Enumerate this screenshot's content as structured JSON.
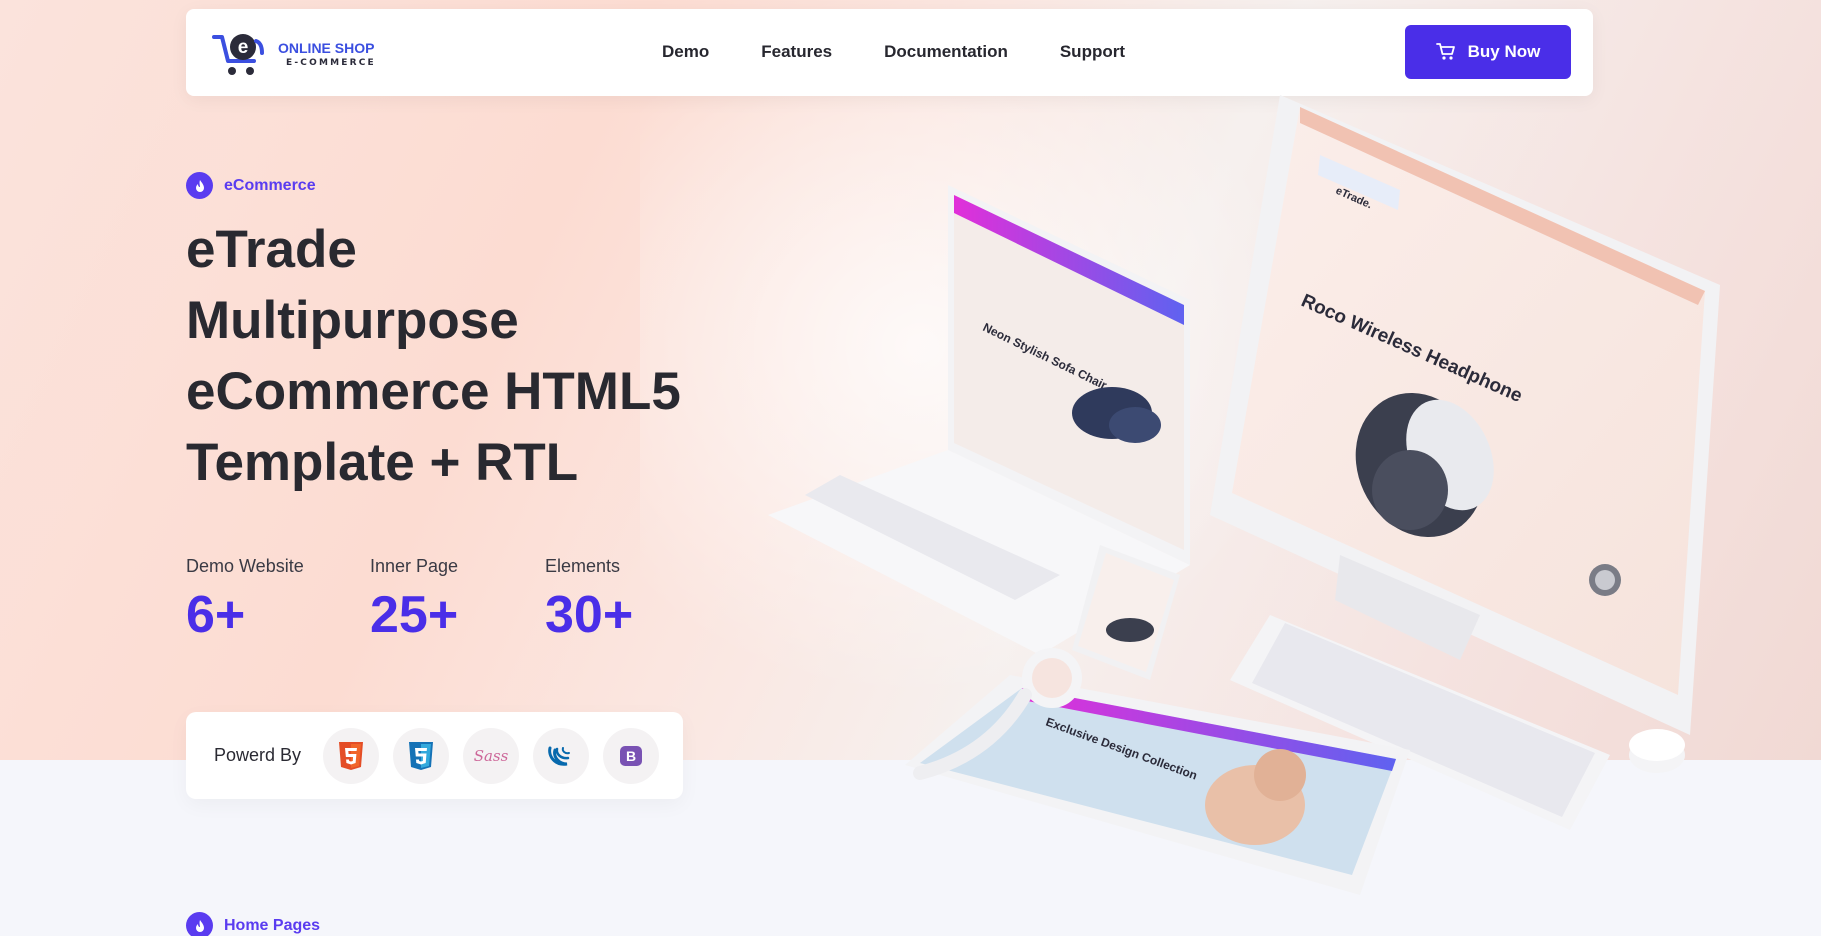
{
  "header": {
    "logo": {
      "title": "ONLINE SHOP",
      "subtitle": "E-COMMERCE"
    },
    "nav": [
      {
        "label": "Demo"
      },
      {
        "label": "Features"
      },
      {
        "label": "Documentation"
      },
      {
        "label": "Support"
      }
    ],
    "buy_button": {
      "label": "Buy Now",
      "icon": "cart-icon"
    }
  },
  "hero": {
    "badge": {
      "label": "eCommerce",
      "icon": "flame-icon"
    },
    "title_lines": [
      "eTrade",
      "Multipurpose",
      "eCommerce HTML5",
      "Template + RTL"
    ],
    "stats": [
      {
        "label": "Demo Website",
        "value": "6+"
      },
      {
        "label": "Inner Page",
        "value": "25+"
      },
      {
        "label": "Elements",
        "value": "30+"
      }
    ],
    "powered_by": {
      "label": "Powerd By",
      "technologies": [
        {
          "name": "HTML5",
          "icon": "html5-icon",
          "color": "#e44d26"
        },
        {
          "name": "CSS3",
          "icon": "css3-icon",
          "color": "#1572b6"
        },
        {
          "name": "Sass",
          "icon": "sass-icon",
          "color": "#cd6799"
        },
        {
          "name": "jQuery",
          "icon": "jquery-icon",
          "color": "#0769ad"
        },
        {
          "name": "Bootstrap",
          "icon": "bootstrap-icon",
          "color": "#7952b3"
        }
      ]
    }
  },
  "mockup": {
    "laptop_text": "Neon Stylish Sofa Chair",
    "monitor_logo": "eTrade.",
    "monitor_text": "Roco Wireless Headphone",
    "tablet_text": "Exclusive Design Collection"
  },
  "next_section": {
    "badge_label": "Home Pages"
  },
  "colors": {
    "accent": "#4a2ee8",
    "badge": "#5a3cf0",
    "heading": "#292930"
  }
}
